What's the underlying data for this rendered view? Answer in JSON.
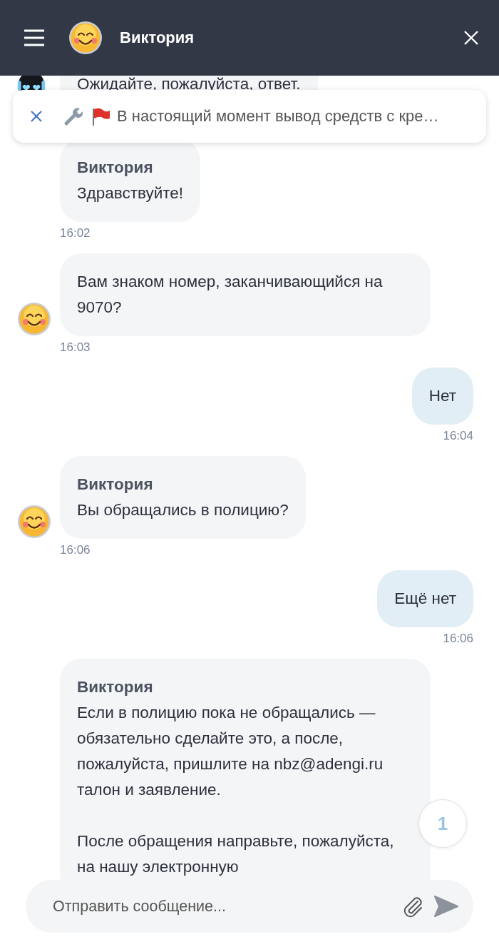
{
  "header": {
    "title": "Виктория"
  },
  "notice": {
    "text": "В настоящий момент вывод средств с кре…"
  },
  "messages": [
    {
      "kind": "bot",
      "avatar": true,
      "paragraphs": [
        "Ожидайте, пожалуйста, ответ."
      ]
    },
    {
      "kind": "incoming",
      "avatar": false,
      "name": "Виктория",
      "paragraphs": [
        "Здравствуйте!"
      ],
      "time": "16:02"
    },
    {
      "kind": "incoming",
      "avatar": true,
      "paragraphs": [
        "Вам знаком номер, заканчивающийся на 9070?"
      ],
      "time": "16:03"
    },
    {
      "kind": "outgoing",
      "paragraphs": [
        "Нет"
      ],
      "time": "16:04"
    },
    {
      "kind": "incoming",
      "avatar": true,
      "name": "Виктория",
      "paragraphs": [
        "Вы обращались в полицию?"
      ],
      "time": "16:06"
    },
    {
      "kind": "outgoing",
      "paragraphs": [
        "Ещё нет"
      ],
      "time": "16:06"
    },
    {
      "kind": "incoming",
      "avatar": false,
      "name": "Виктория",
      "paragraphs": [
        "Если в полицию пока не обращались — обязательно сделайте это, а после, пожалуйста, пришлите на nbz@adengi.ru талон и заявление.",
        "После обращения направьте, пожалуйста, на нашу электронную"
      ]
    }
  ],
  "unread_badge": "1",
  "composer": {
    "placeholder": "Отправить сообщение..."
  }
}
